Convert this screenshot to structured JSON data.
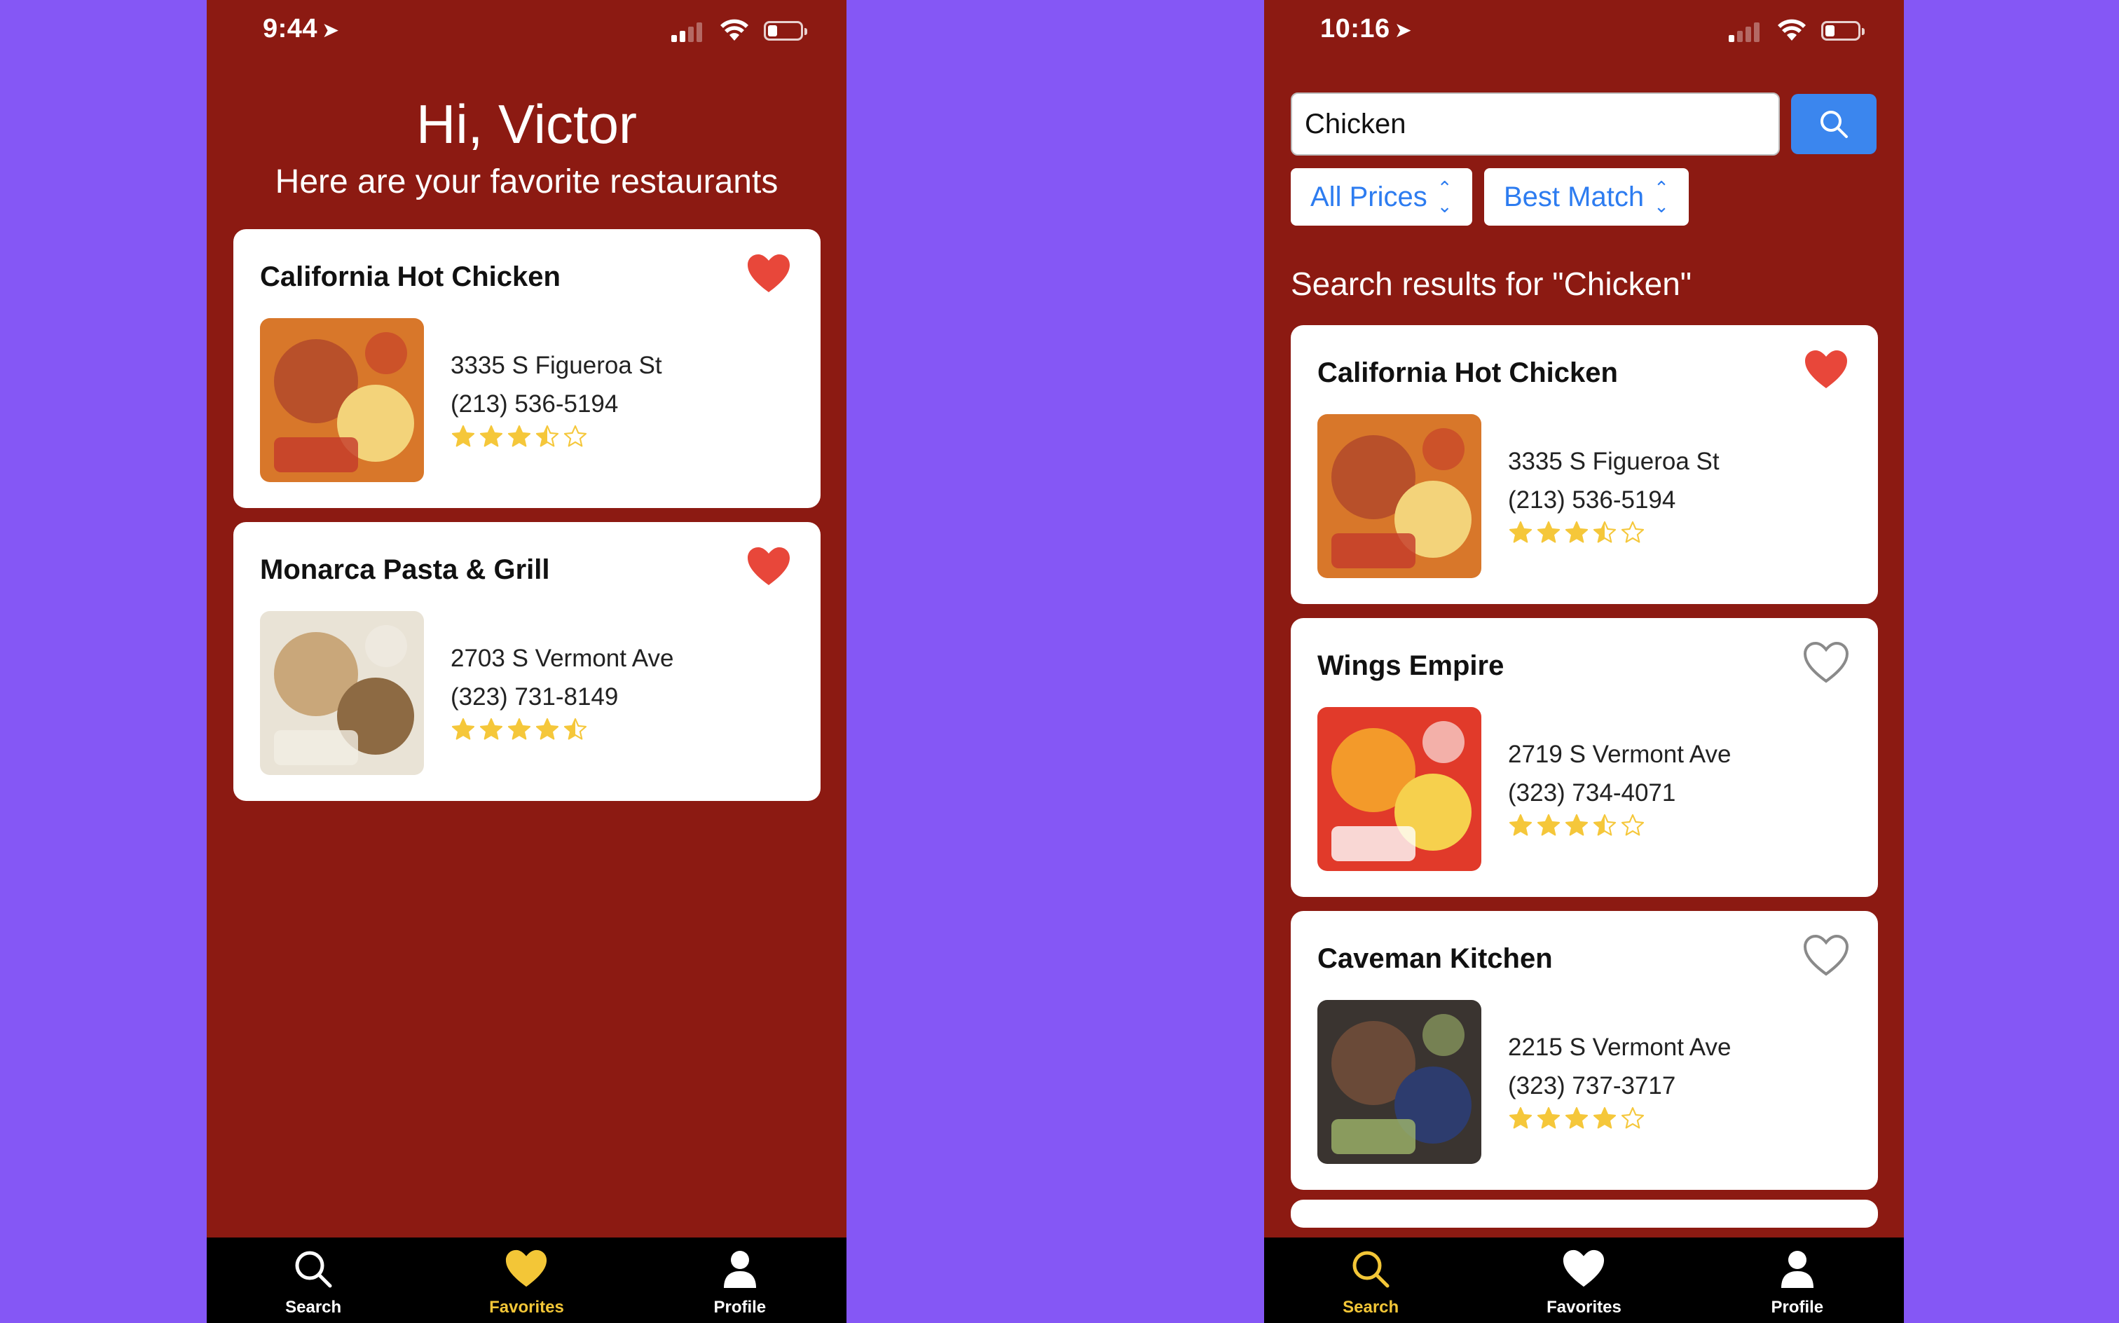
{
  "colors": {
    "background": "#8557f5",
    "app_background": "#8c1a12",
    "heart_filled": "#e8473a",
    "star": "#f5c73a",
    "tab_active": "#f3c637",
    "search_button": "#3b86ee",
    "filter_text": "#2d7cf0"
  },
  "left_screen": {
    "status": {
      "time": "9:44",
      "battery_level": 0.3
    },
    "greeting": "Hi, Victor",
    "subtitle": "Here are your favorite restaurants",
    "restaurants": [
      {
        "name": "California Hot Chicken",
        "address": "3335 S Figueroa St",
        "phone": "(213) 536-5194",
        "rating": 3.5,
        "favorite": true,
        "image_icon": "food-photo"
      },
      {
        "name": "Monarca Pasta & Grill",
        "address": "2703 S Vermont Ave",
        "phone": "(323) 731-8149",
        "rating": 4.5,
        "favorite": true,
        "image_icon": "food-photo"
      }
    ],
    "tabs": [
      {
        "label": "Search",
        "icon": "search-icon",
        "active": false
      },
      {
        "label": "Favorites",
        "icon": "heart-icon",
        "active": true
      },
      {
        "label": "Profile",
        "icon": "person-icon",
        "active": false
      }
    ]
  },
  "right_screen": {
    "status": {
      "time": "10:16",
      "battery_level": 0.3
    },
    "search": {
      "value": "Chicken"
    },
    "filters": {
      "price": "All Prices",
      "sort": "Best Match"
    },
    "results_heading": "Search results for \"Chicken\"",
    "restaurants": [
      {
        "name": "California Hot Chicken",
        "address": "3335 S Figueroa St",
        "phone": "(213) 536-5194",
        "rating": 3.5,
        "favorite": true,
        "image_icon": "food-photo"
      },
      {
        "name": "Wings Empire",
        "address": "2719 S Vermont Ave",
        "phone": "(323) 734-4071",
        "rating": 3.5,
        "favorite": false,
        "image_icon": "food-photo"
      },
      {
        "name": "Caveman Kitchen",
        "address": "2215 S Vermont Ave",
        "phone": "(323) 737-3717",
        "rating": 4,
        "favorite": false,
        "image_icon": "food-photo"
      }
    ],
    "tabs": [
      {
        "label": "Search",
        "icon": "search-icon",
        "active": true
      },
      {
        "label": "Favorites",
        "icon": "heart-icon",
        "active": false
      },
      {
        "label": "Profile",
        "icon": "person-icon",
        "active": false
      }
    ]
  }
}
